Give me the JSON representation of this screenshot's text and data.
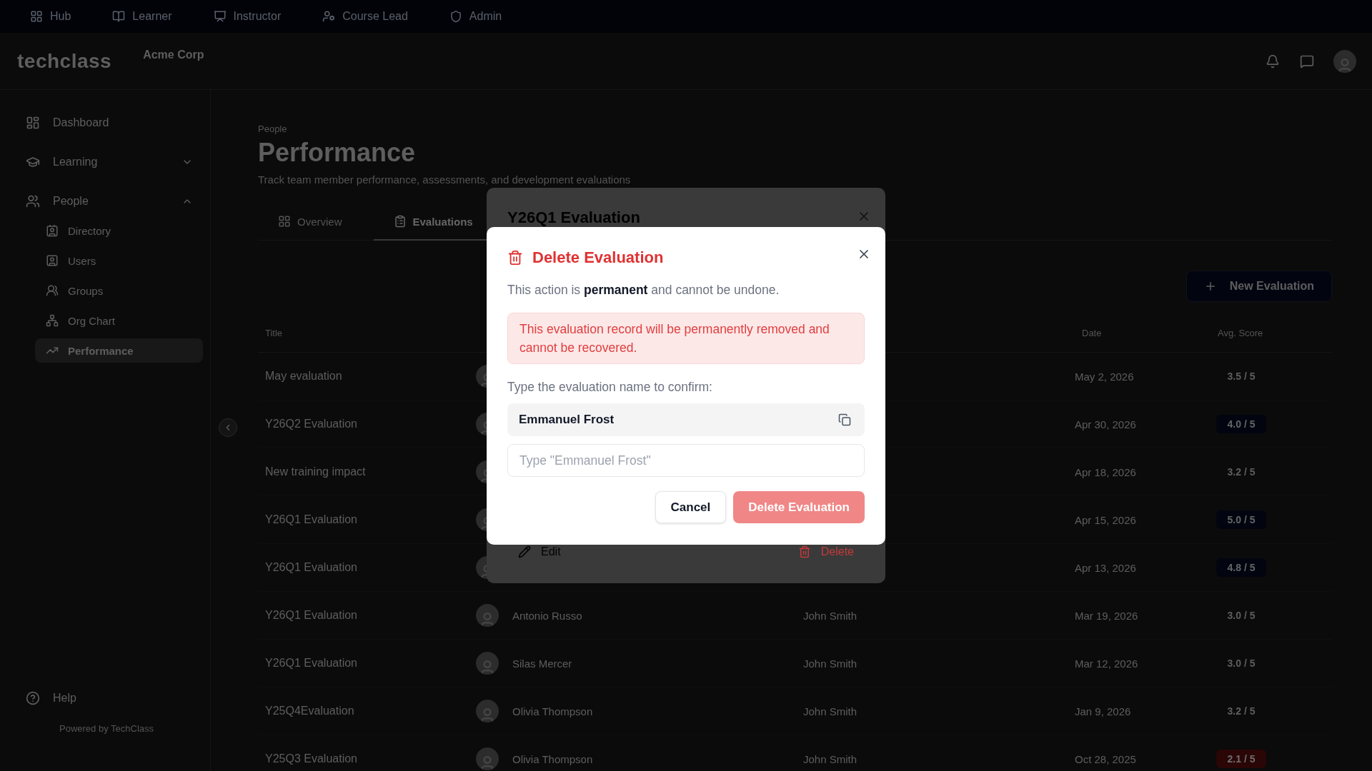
{
  "top_nav": [
    "Hub",
    "Learner",
    "Instructor",
    "Course Lead",
    "Admin"
  ],
  "header": {
    "logo": "techclass",
    "org_name": "Acme Corp"
  },
  "sidebar": {
    "items": [
      {
        "label": "Dashboard",
        "kind": "link",
        "selected": false
      },
      {
        "label": "Learning",
        "kind": "group",
        "expanded": false,
        "selected": false
      },
      {
        "label": "People",
        "kind": "group",
        "expanded": true,
        "selected": false,
        "children": [
          {
            "label": "Directory",
            "selected": false
          },
          {
            "label": "Users",
            "selected": false
          },
          {
            "label": "Groups",
            "selected": false
          },
          {
            "label": "Org Chart",
            "selected": false
          },
          {
            "label": "Performance",
            "selected": true
          }
        ]
      }
    ],
    "help": "Help",
    "footer": "Powered by TechClass"
  },
  "page": {
    "breadcrumb": "People",
    "title": "Performance",
    "subtitle": "Track team member performance, assessments, and development evaluations"
  },
  "tabs": [
    {
      "label": "Overview",
      "selected": false
    },
    {
      "label": "Evaluations",
      "selected": true
    }
  ],
  "new_button": "New Evaluation",
  "table": {
    "columns": [
      "Title",
      "Date",
      "Avg. Score"
    ],
    "rows": [
      {
        "title": "May evaluation",
        "date": "May 2, 2026",
        "score": "3.5 / 5",
        "kind": "plain"
      },
      {
        "title": "Y26Q2 Evaluation",
        "date": "Apr 30, 2026",
        "score": "4.0 / 5",
        "kind": "top"
      },
      {
        "title": "New training impact",
        "date": "Apr 18, 2026",
        "score": "3.2 / 5",
        "kind": "plain"
      },
      {
        "title": "Y26Q1 Evaluation",
        "date": "Apr 15, 2026",
        "score": "5.0 / 5",
        "kind": "top"
      },
      {
        "title": "Y26Q1 Evaluation",
        "date": "Apr 13, 2026",
        "score": "4.8 / 5",
        "kind": "top"
      },
      {
        "title": "Y26Q1 Evaluation",
        "employee": "Antonio Russo",
        "evaluator": "John Smith",
        "date": "Mar 19, 2026",
        "score": "3.0 / 5",
        "kind": "plain"
      },
      {
        "title": "Y26Q1 Evaluation",
        "employee": "Silas Mercer",
        "evaluator": "John Smith",
        "date": "Mar 12, 2026",
        "score": "3.0 / 5",
        "kind": "plain"
      },
      {
        "title": "Y25Q4Evaluation",
        "employee": "Olivia Thompson",
        "evaluator": "John Smith",
        "date": "Jan 9, 2026",
        "score": "3.2 / 5",
        "kind": "plain"
      },
      {
        "title": "Y25Q3 Evaluation",
        "employee": "Olivia Thompson",
        "evaluator": "John Smith",
        "date": "Oct 28, 2025",
        "score": "2.1 / 5",
        "kind": "low"
      }
    ]
  },
  "evaluation_modal": {
    "title": "Y26Q1 Evaluation",
    "actions": [
      {
        "label": "Edit",
        "kind": "edit"
      },
      {
        "label": "Delete",
        "kind": "delete"
      }
    ]
  },
  "delete_dialog": {
    "title": "Delete Evaluation",
    "message": "This action is **permanent** and cannot be undone.",
    "warning": "This evaluation record will be permanently removed and cannot be recovered.",
    "confirm_label": "Type the evaluation name to confirm:",
    "name": "Emmanuel Frost",
    "input": {
      "placeholder": "Type \"Emmanuel Frost\""
    },
    "buttons": [
      {
        "label": "Cancel",
        "kind": "secondary",
        "disabled": false
      },
      {
        "label": "Delete Evaluation",
        "kind": "danger",
        "disabled": true
      }
    ]
  }
}
